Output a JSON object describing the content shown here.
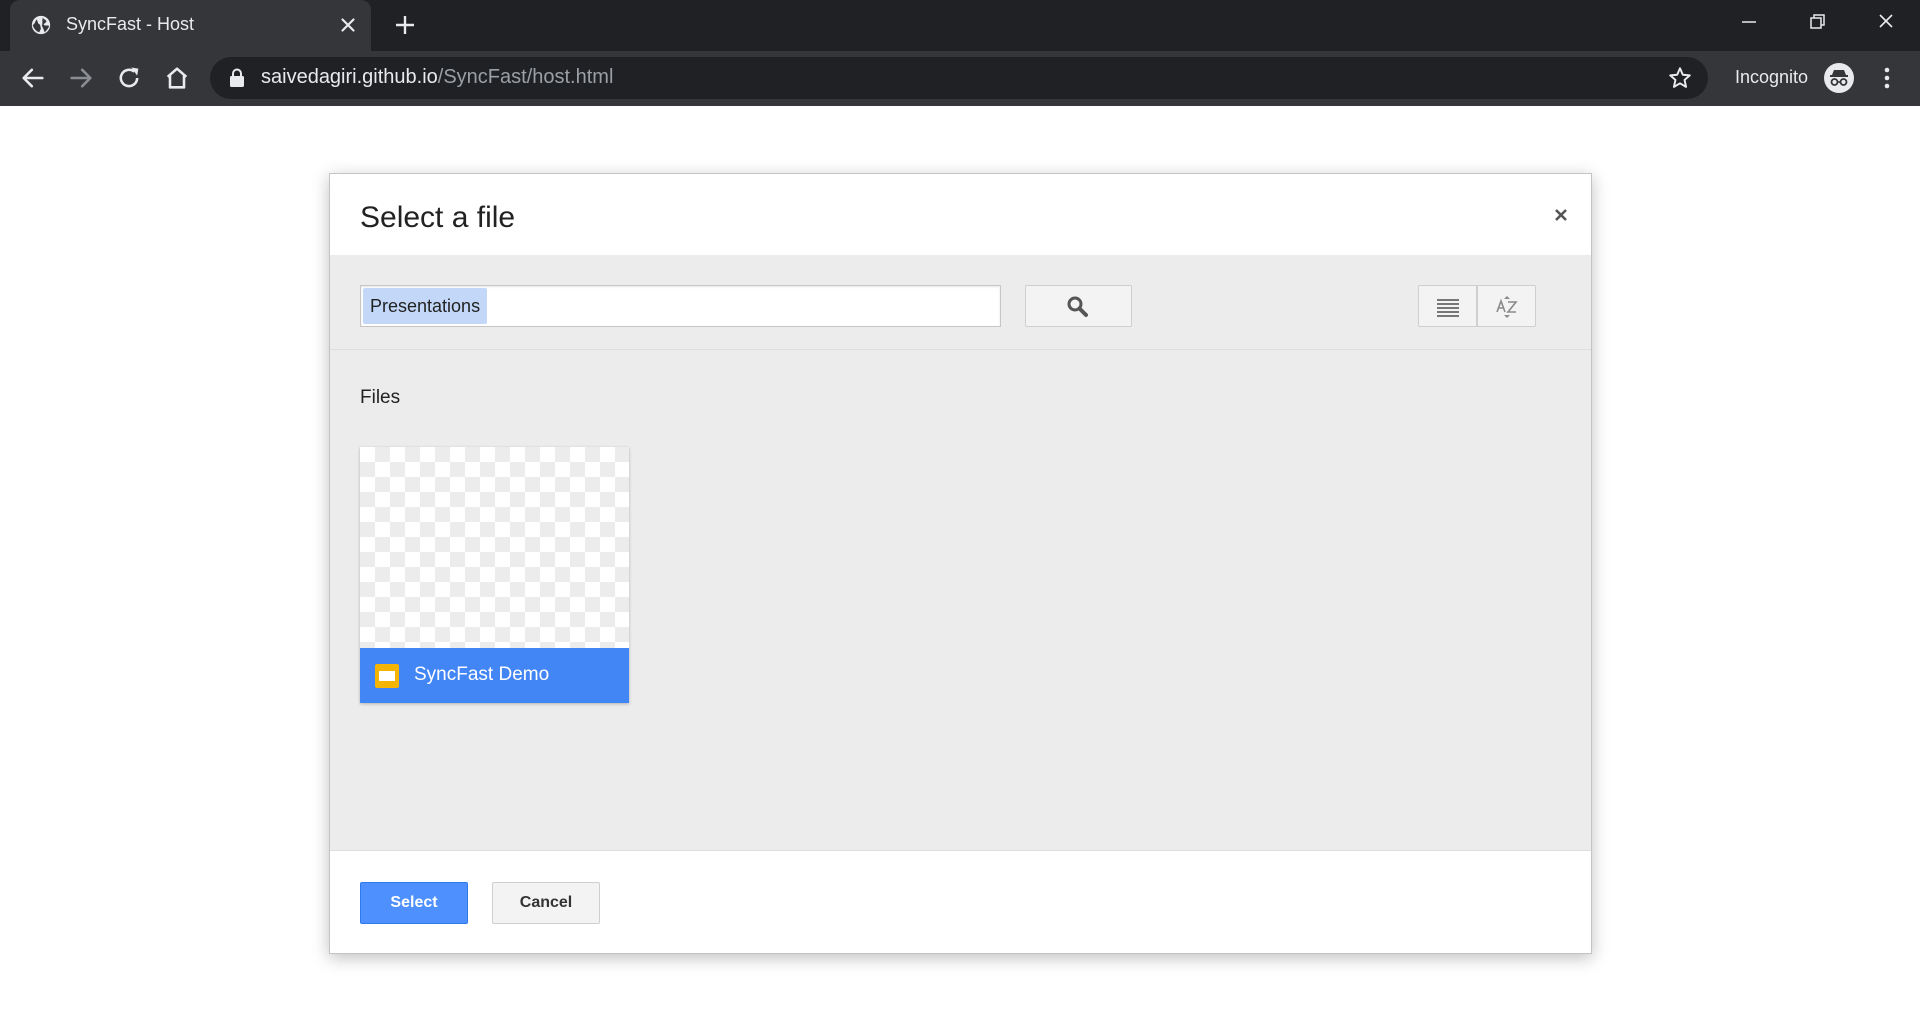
{
  "browser": {
    "tab_title": "SyncFast - Host",
    "url_host": "saivedagiri.github.io",
    "url_path": "/SyncFast/host.html",
    "incognito_label": "Incognito",
    "icons": [
      "globe-icon",
      "close-icon",
      "plus-icon",
      "minimize-icon",
      "restore-icon",
      "window-close-icon",
      "back-arrow-icon",
      "forward-arrow-icon",
      "reload-icon",
      "home-icon",
      "lock-icon",
      "star-icon",
      "incognito-icon",
      "kebab-menu-icon"
    ]
  },
  "dialog": {
    "title": "Select a file",
    "close_icon": "close-icon",
    "search": {
      "value": "Presentations",
      "button_icon": "search-icon"
    },
    "view_icons": [
      "list-view-icon",
      "sort-az-icon"
    ],
    "section_label": "Files",
    "files": [
      {
        "name": "SyncFast Demo",
        "type_icon": "google-slides-icon",
        "selected": true
      }
    ],
    "buttons": {
      "select": "Select",
      "cancel": "Cancel"
    }
  },
  "colors": {
    "accent": "#4285f4",
    "select_button": "#4d90fe",
    "chrome_dark": "#202124",
    "chrome_toolbar": "#35363a",
    "slides_yellow": "#f4b400"
  }
}
